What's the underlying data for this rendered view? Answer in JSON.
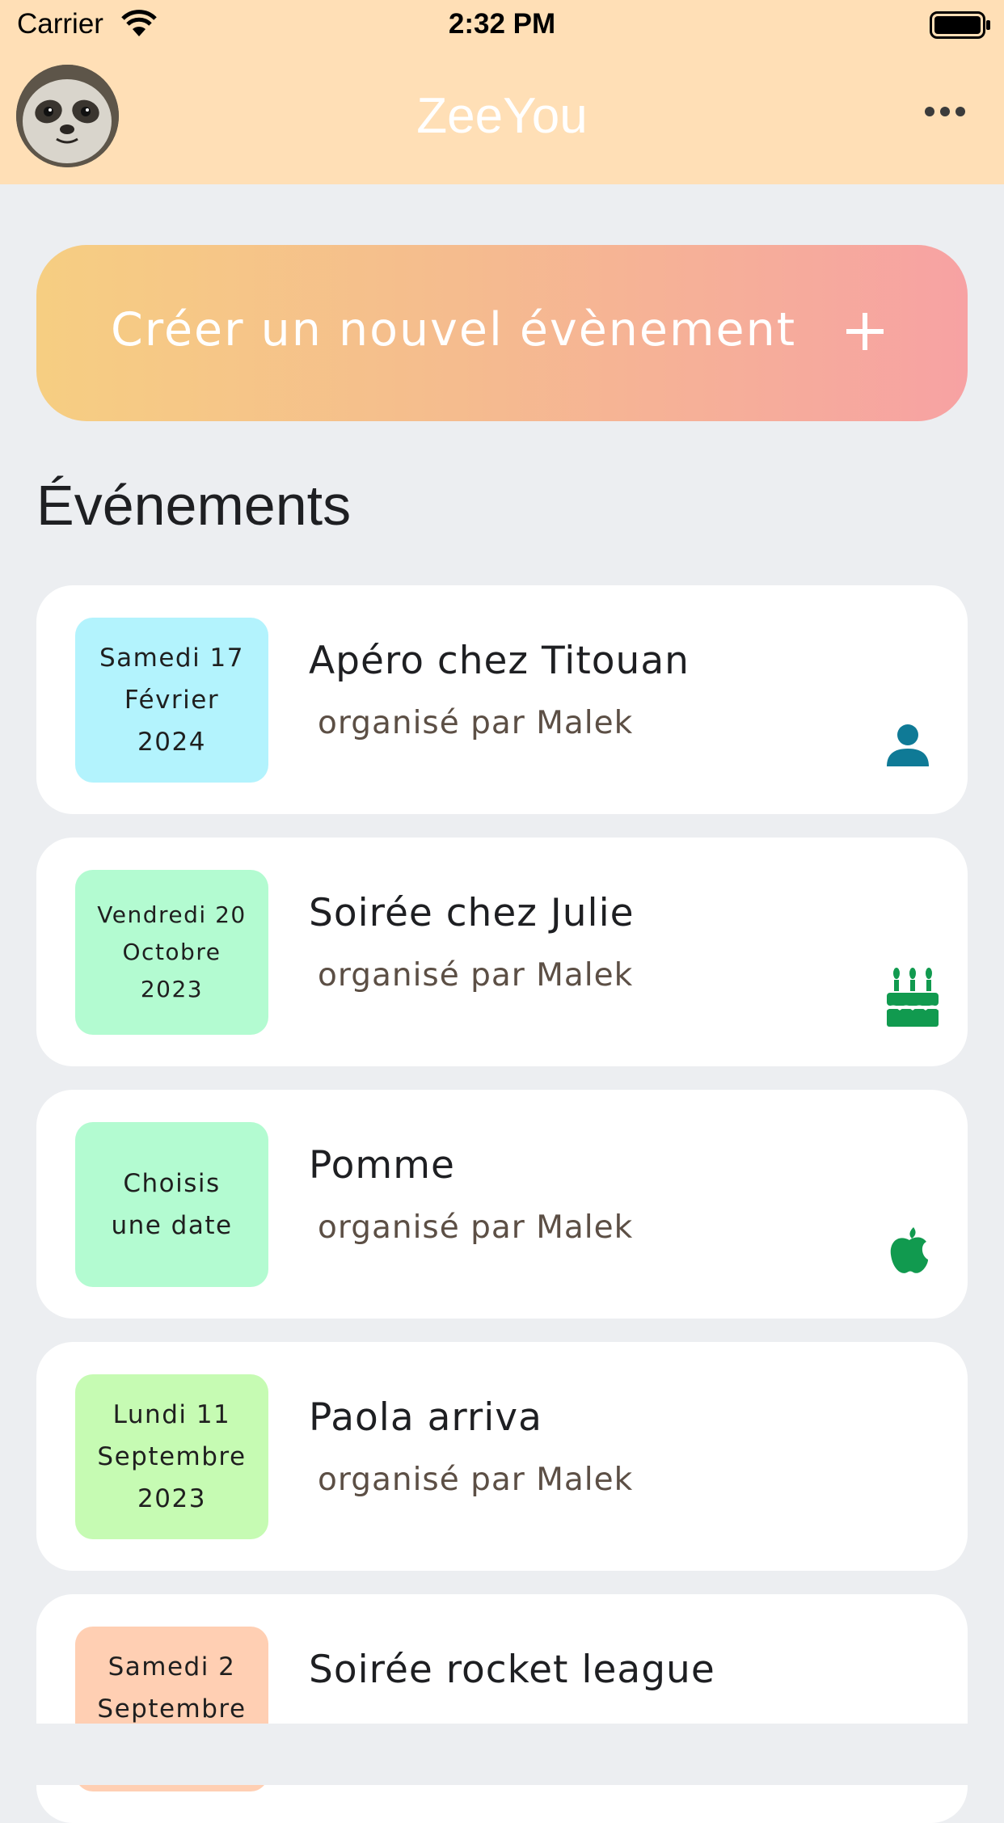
{
  "status_bar": {
    "carrier": "Carrier",
    "time": "2:32 PM"
  },
  "header": {
    "title": "ZeeYou"
  },
  "create_button": {
    "label": "Créer un nouvel évènement",
    "icon": "plus-icon"
  },
  "section": {
    "title": "Événements"
  },
  "events": [
    {
      "date": "Samedi 17\nFévrier\n2024",
      "title": "Apéro chez Titouan",
      "organizer": "organisé par Malek",
      "badge_color": "#b3f3fd",
      "icon": "person-icon",
      "icon_color": "#0f7a96"
    },
    {
      "date": "Vendredi 20\nOctobre\n2023",
      "title": "Soirée chez Julie",
      "organizer": "organisé par Malek",
      "badge_color": "#b3fbd1",
      "icon": "birthday-cake-icon",
      "icon_color": "#119a4f"
    },
    {
      "date": "Choisis\nune date",
      "title": "Pomme",
      "organizer": "organisé par Malek",
      "badge_color": "#b3fbd1",
      "icon": "apple-icon",
      "icon_color": "#119a4f"
    },
    {
      "date": "Lundi 11\nSeptembre\n2023",
      "title": "Paola arriva",
      "organizer": "organisé par Malek",
      "badge_color": "#c6fbb3",
      "icon": "",
      "icon_color": ""
    },
    {
      "date": "Samedi 2\nSeptembre",
      "title": "Soirée rocket league",
      "organizer": "",
      "badge_color": "#ffcfb3",
      "icon": "",
      "icon_color": ""
    }
  ]
}
